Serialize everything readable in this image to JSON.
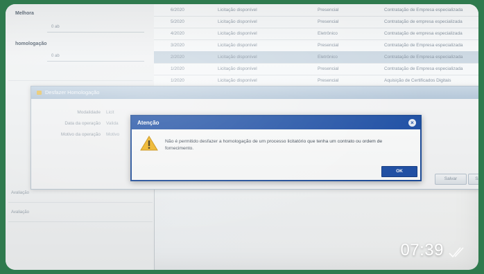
{
  "left_panel": {
    "section1_label": "Melhora",
    "section1_value": "0 ab",
    "section2_label": "homologação",
    "section2_value": "0 ab",
    "rows": [
      "",
      "",
      "",
      "Avaliação",
      "Avaliação"
    ]
  },
  "grid": {
    "rows": [
      {
        "date": "6/2020",
        "status": "Licitação disponível",
        "type": "Presencial",
        "desc": "Contratação de Empresa especializada"
      },
      {
        "date": "5/2020",
        "status": "Licitação disponível",
        "type": "Presencial",
        "desc": "Contratação de empresa especializada"
      },
      {
        "date": "4/2020",
        "status": "Licitação disponível",
        "type": "Eletrônico",
        "desc": "Contratação de empresa especializada"
      },
      {
        "date": "3/2020",
        "status": "Licitação disponível",
        "type": "Presencial",
        "desc": "Contratação de Empresa especializada"
      },
      {
        "date": "2/2020",
        "status": "Licitação disponível",
        "type": "Eletrônico",
        "desc": "Contratação de Empresa especializada"
      },
      {
        "date": "1/2020",
        "status": "Licitação disponível",
        "type": "Presencial",
        "desc": "Contratação de Empresa especializada"
      },
      {
        "date": "1/2020",
        "status": "Licitação disponível",
        "type": "Presencial",
        "desc": "Aquisição de Certificados Digitais"
      }
    ]
  },
  "background_dialog": {
    "title": "Desfazer Homologação",
    "labels": [
      "Modalidade",
      "Data da operação",
      "Motivo da operação"
    ],
    "values": [
      "Licit",
      "Valida",
      "Motivo"
    ],
    "buttons": {
      "confirm": "Salvar",
      "cancel": "Sair"
    }
  },
  "alert": {
    "title": "Atenção",
    "close": "×",
    "message": "Não é permitido desfazer a homologação de um processo licitatório que tenha um contrato ou ordem de fornecimento.",
    "ok_label": "OK"
  },
  "overlay": {
    "time": "07:39"
  }
}
